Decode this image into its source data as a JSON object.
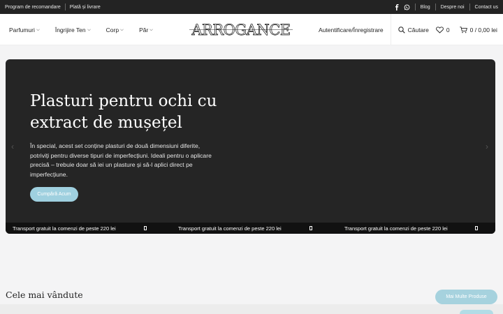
{
  "topbar": {
    "left_links": [
      "Program de recomandare",
      "Plată și livrare"
    ],
    "social": [
      "facebook-icon",
      "whatsapp-icon"
    ],
    "right_links": [
      "Blog",
      "Despre noi",
      "Contact us"
    ]
  },
  "header": {
    "nav": [
      "Parfumuri",
      "Îngrijire Ten",
      "Corp",
      "Păr"
    ],
    "logo_text": "ARROGANCE",
    "login": "Autentificare/Înregistrare",
    "search": "Căutare",
    "wishlist_count": "0",
    "cart_count": "0",
    "cart_total": "0,00 lei"
  },
  "hero": {
    "title": "Plasturi pentru ochi cu extract de mușețel",
    "description": "În special, acest set conține plasturi de două dimensiuni diferite, potriviți pentru diverse tipuri de imperfecțiuni. Ideali pentru o aplicare precisă – trebuie doar să iei un plasture și să-l aplici direct pe imperfecțiune.",
    "cta": "Cumpără Acum",
    "ticker": [
      "Transport gratuit la comenzi de peste 220 lei",
      "Transport gratuit la comenzi de peste 220 lei",
      "Transport gratuit la comenzi de peste 220 lei"
    ]
  },
  "bestsellers": {
    "title": "Cele mai vândute",
    "more_button": "Mai Multe Produse"
  },
  "colors": {
    "accent": "#9fd0df",
    "topbar_bg": "#232323",
    "hero_bg": "#252525"
  }
}
